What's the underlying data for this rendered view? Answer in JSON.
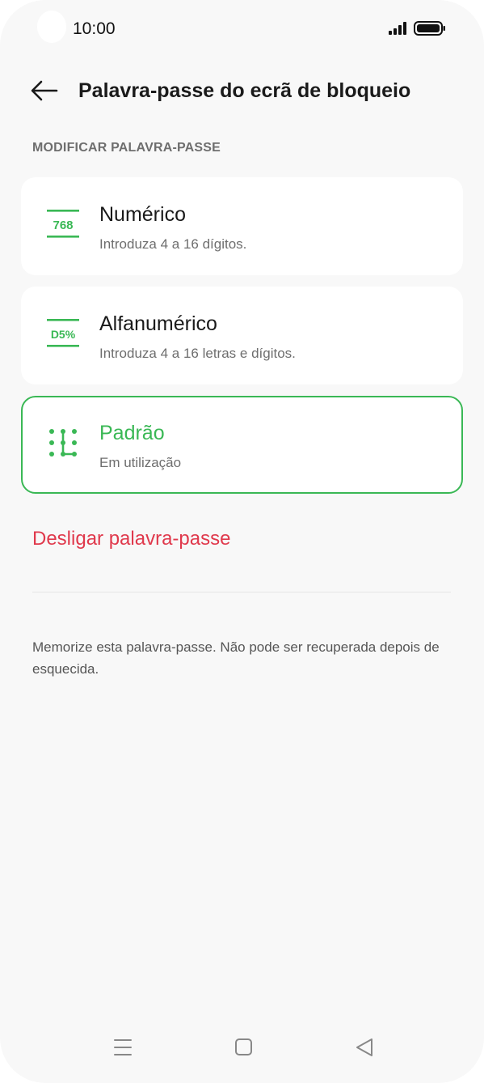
{
  "status_bar": {
    "time": "10:00",
    "icons": [
      "signal-icon",
      "battery-icon"
    ]
  },
  "header": {
    "back_icon": "arrow-left-icon",
    "title": "Palavra-passe do ecrã de bloqueio"
  },
  "section": {
    "label": "MODIFICAR PALAVRA-PASSE"
  },
  "options": [
    {
      "icon_text": "768",
      "title": "Numérico",
      "subtitle": "Introduza 4 a 16 dígitos.",
      "selected": false
    },
    {
      "icon_text": "D5%",
      "title": "Alfanumérico",
      "subtitle": "Introduza 4 a 16 letras e dígitos.",
      "selected": false
    },
    {
      "icon": "pattern-grid-icon",
      "title": "Padrão",
      "subtitle": "Em utilização",
      "selected": true
    }
  ],
  "actions": {
    "disable_label": "Desligar palavra-passe"
  },
  "note": "Memorize esta palavra-passe. Não pode ser recuperada depois de esquecida.",
  "navigation": {
    "icons": [
      "menu-icon",
      "home-icon",
      "back-triangle-icon"
    ]
  },
  "colors": {
    "accent_green": "#3ab855",
    "danger_red": "#e0394c",
    "background": "#f8f8f8",
    "card": "#ffffff"
  }
}
